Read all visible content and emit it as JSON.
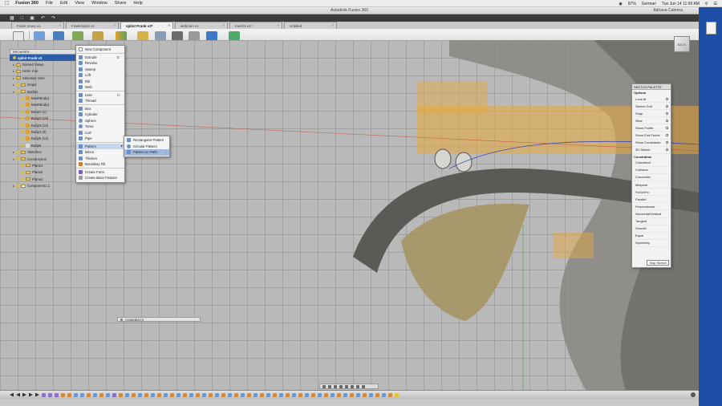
{
  "menubar": {
    "app_name": "Fusion 360",
    "items": [
      "File",
      "Edit",
      "View",
      "Window",
      "Share",
      "Help"
    ],
    "battery": "97%",
    "language": "German",
    "clock": "Tue Jun 14  11:00 AM"
  },
  "window": {
    "title": "Autodesk Fusion 360",
    "user": "Adriana Cabrera"
  },
  "doc_tabs": [
    {
      "label": "Frank new1 v1"
    },
    {
      "label": "FrankSplint v1"
    },
    {
      "label": "splint Frank v3*",
      "active": true
    },
    {
      "label": "webcam v1"
    },
    {
      "label": "mesh3 v1*"
    },
    {
      "label": "Untitled"
    }
  ],
  "toolbar": {
    "tools": [
      "MODEL",
      "SKETCH",
      "CREATE",
      "MODIFY",
      "ASSEMBLE",
      "CONSTRUCT",
      "INSPECT",
      "INSERT",
      "MAKE",
      "ADD-INS",
      "SELECT",
      "STOP SKETCH"
    ]
  },
  "browser": {
    "header": "BROWSER",
    "rows": [
      {
        "label": "splint Frank v3",
        "root": true
      },
      {
        "label": "Named Views"
      },
      {
        "label": "Units: mm"
      },
      {
        "label": "Selection Sets"
      },
      {
        "label": "Origin"
      },
      {
        "label": "Bodies"
      },
      {
        "label": "MeshBody1"
      },
      {
        "label": "MeshBody1"
      },
      {
        "label": "Body1 (1)"
      },
      {
        "label": "Body2 (10)"
      },
      {
        "label": "Body3 (10)"
      },
      {
        "label": "Body4 (3)"
      },
      {
        "label": "Body5 (12)"
      },
      {
        "label": "Body6"
      },
      {
        "label": "Sketches"
      },
      {
        "label": "Construction"
      },
      {
        "label": "Plane1"
      },
      {
        "label": "Plane2"
      },
      {
        "label": "Plane3"
      },
      {
        "label": "Component1:1"
      }
    ]
  },
  "create_menu": {
    "items": [
      {
        "label": "New Component"
      },
      {
        "label": "Extrude",
        "shortcut": "E"
      },
      {
        "label": "Revolve"
      },
      {
        "label": "Sweep"
      },
      {
        "label": "Loft"
      },
      {
        "label": "Rib"
      },
      {
        "label": "Web"
      },
      {
        "label": "Hole",
        "shortcut": "H"
      },
      {
        "label": "Thread"
      },
      {
        "label": "Box"
      },
      {
        "label": "Cylinder"
      },
      {
        "label": "Sphere"
      },
      {
        "label": "Torus"
      },
      {
        "label": "Coil"
      },
      {
        "label": "Pipe"
      },
      {
        "label": "Pattern",
        "highlighted": true
      },
      {
        "label": "Mirror"
      },
      {
        "label": "Thicken"
      },
      {
        "label": "Boundary Fill"
      },
      {
        "label": "Create Form"
      },
      {
        "label": "Create Base Feature"
      }
    ]
  },
  "pattern_submenu": {
    "items": [
      "Rectangular Pattern",
      "Circular Pattern",
      "Pattern on Path"
    ]
  },
  "comments": {
    "label": "COMMENTS"
  },
  "sketch_palette": {
    "title": "SKETCH PALETTE",
    "options_header": "Options",
    "options": [
      "Look At",
      "Sketch Grid",
      "Snap",
      "Slice",
      "Show Profile",
      "Show End Points",
      "Show Constraints",
      "3D Sketch"
    ],
    "constraints_header": "Constraints",
    "constraints": [
      "Coincident",
      "Collinear",
      "Concentric",
      "Midpoint",
      "Fix/UnFix",
      "Parallel",
      "Perpendicular",
      "Horizontal/Vertical",
      "Tangent",
      "Smooth",
      "Equal",
      "Symmetry"
    ],
    "stop_button": "Stop Sketch"
  },
  "viewcube": {
    "label": "BACK"
  },
  "colors": {
    "accent": "#1e6fc6",
    "body_orange": "#e8a93a",
    "desktop": "#1c4fa5"
  }
}
